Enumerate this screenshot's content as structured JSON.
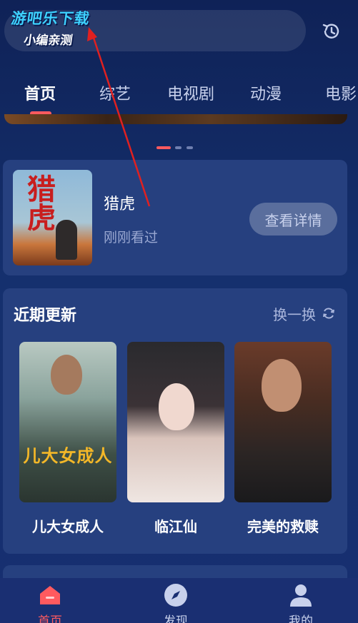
{
  "watermark": {
    "line1": "游吧乐下载",
    "line2": "小编亲测"
  },
  "search": {
    "placeholder": ""
  },
  "tabs": [
    {
      "label": "首页"
    },
    {
      "label": "综艺"
    },
    {
      "label": "电视剧"
    },
    {
      "label": "动漫"
    },
    {
      "label": "电影"
    }
  ],
  "history": {
    "poster_title": "猎虎",
    "title": "猎虎",
    "subtitle": "刚刚看过",
    "button": "查看详情"
  },
  "recent": {
    "title": "近期更新",
    "refresh_label": "换一换",
    "items": [
      {
        "label": "儿大女成人",
        "overlay": "儿大女成人"
      },
      {
        "label": "临江仙"
      },
      {
        "label": "完美的救赎"
      }
    ]
  },
  "nav": [
    {
      "label": "首页",
      "icon": "home-icon"
    },
    {
      "label": "发现",
      "icon": "compass-icon"
    },
    {
      "label": "我的",
      "icon": "profile-icon"
    }
  ],
  "colors": {
    "accent": "#ff5a5f",
    "background": "#142a66",
    "card": "#26407f"
  }
}
